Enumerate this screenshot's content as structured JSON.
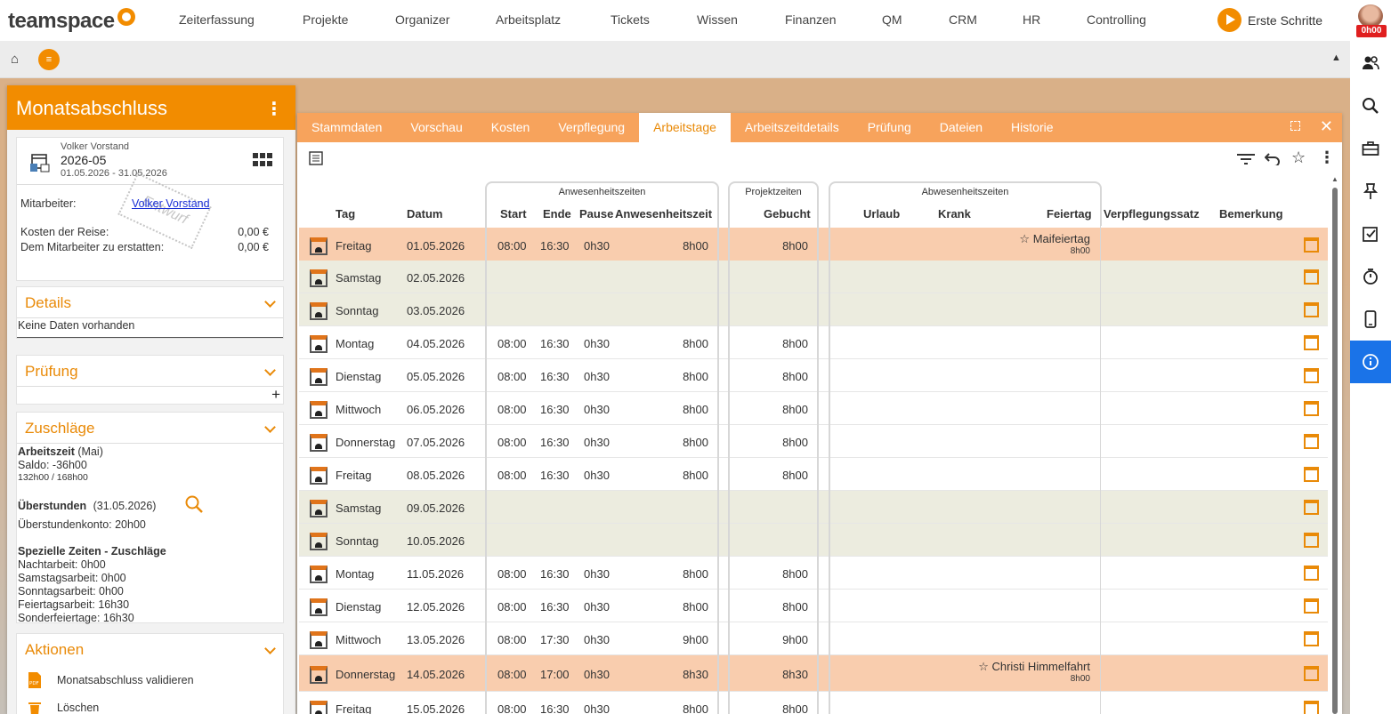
{
  "brand": {
    "logo_text": "teamspace"
  },
  "topnav": {
    "items": [
      "Zeiterfassung",
      "Projekte",
      "Organizer",
      "Arbeitsplatz",
      "Tickets",
      "Wissen",
      "Finanzen",
      "QM",
      "CRM",
      "HR",
      "Controlling"
    ],
    "erste_schritte": "Erste Schritte"
  },
  "user": {
    "time_badge": "0h00"
  },
  "left": {
    "title": "Monatsabschluss",
    "summary": {
      "employee_small": "Volker Vorstand",
      "period": "2026-05",
      "range": "01.05.2026 - 31.05.2026",
      "mitarbeiter_label": "Mitarbeiter:",
      "mitarbeiter_value": "Volker Vorstand",
      "kosten_label": "Kosten der Reise:",
      "kosten_value": "0,00 €",
      "erstatten_label": "Dem Mitarbeiter zu erstatten:",
      "erstatten_value": "0,00 €",
      "stamp": "Entwurf"
    },
    "details": {
      "title": "Details",
      "empty": "Keine Daten vorhanden"
    },
    "pruefung": {
      "title": "Prüfung"
    },
    "zuschlaege": {
      "title": "Zuschläge",
      "arbeitszeit_label": "Arbeitszeit",
      "arbeitszeit_month": "(Mai)",
      "saldo": "Saldo: -36h00",
      "ratio": "132h00 / 168h00",
      "ueberstunden_label": "Überstunden",
      "ueberstunden_date": "(31.05.2026)",
      "ueberstundenkonto": "Überstundenkonto: 20h00",
      "spezielle_title": "Spezielle Zeiten - Zuschläge",
      "nachtarbeit": "Nachtarbeit: 0h00",
      "samstagsarbeit": "Samstagsarbeit: 0h00",
      "sonntagsarbeit": "Sonntagsarbeit: 0h00",
      "feiertagsarbeit": "Feiertagsarbeit: 16h30",
      "sonderfeiertage": "Sonderfeiertage: 16h30"
    },
    "aktionen": {
      "title": "Aktionen",
      "validieren": "Monatsabschluss validieren",
      "loeschen": "Löschen"
    }
  },
  "main": {
    "tabs": [
      "Stammdaten",
      "Vorschau",
      "Kosten",
      "Verpflegung",
      "Arbeitstage",
      "Arbeitszeitdetails",
      "Prüfung",
      "Dateien",
      "Historie"
    ],
    "active_tab": "Arbeitstage",
    "groups": {
      "anwesenheit": "Anwesenheitszeiten",
      "projekt": "Projektzeiten",
      "abwesenheit": "Abwesenheitszeiten"
    },
    "columns": {
      "tag": "Tag",
      "datum": "Datum",
      "start": "Start",
      "ende": "Ende",
      "pause": "Pause",
      "anwesenheitszeit": "Anwesenheitszeit",
      "gebucht": "Gebucht",
      "urlaub": "Urlaub",
      "krank": "Krank",
      "feiertag": "Feiertag",
      "verpflegungssatz": "Verpflegungssatz",
      "bemerkung": "Bemerkung"
    },
    "rows": [
      {
        "type": "holiday",
        "tag": "Freitag",
        "datum": "01.05.2026",
        "start": "08:00",
        "ende": "16:30",
        "pause": "0h30",
        "anw": "8h00",
        "gebucht": "8h00",
        "feiertag": "Maifeiertag",
        "feiertag_h": "8h00"
      },
      {
        "type": "weekend",
        "tag": "Samstag",
        "datum": "02.05.2026",
        "start": "",
        "ende": "",
        "pause": "",
        "anw": "",
        "gebucht": "",
        "feiertag": "",
        "feiertag_h": ""
      },
      {
        "type": "weekend",
        "tag": "Sonntag",
        "datum": "03.05.2026",
        "start": "",
        "ende": "",
        "pause": "",
        "anw": "",
        "gebucht": "",
        "feiertag": "",
        "feiertag_h": ""
      },
      {
        "type": "normal",
        "tag": "Montag",
        "datum": "04.05.2026",
        "start": "08:00",
        "ende": "16:30",
        "pause": "0h30",
        "anw": "8h00",
        "gebucht": "8h00",
        "feiertag": "",
        "feiertag_h": ""
      },
      {
        "type": "normal",
        "tag": "Dienstag",
        "datum": "05.05.2026",
        "start": "08:00",
        "ende": "16:30",
        "pause": "0h30",
        "anw": "8h00",
        "gebucht": "8h00",
        "feiertag": "",
        "feiertag_h": ""
      },
      {
        "type": "normal",
        "tag": "Mittwoch",
        "datum": "06.05.2026",
        "start": "08:00",
        "ende": "16:30",
        "pause": "0h30",
        "anw": "8h00",
        "gebucht": "8h00",
        "feiertag": "",
        "feiertag_h": ""
      },
      {
        "type": "normal",
        "tag": "Donnerstag",
        "datum": "07.05.2026",
        "start": "08:00",
        "ende": "16:30",
        "pause": "0h30",
        "anw": "8h00",
        "gebucht": "8h00",
        "feiertag": "",
        "feiertag_h": ""
      },
      {
        "type": "normal",
        "tag": "Freitag",
        "datum": "08.05.2026",
        "start": "08:00",
        "ende": "16:30",
        "pause": "0h30",
        "anw": "8h00",
        "gebucht": "8h00",
        "feiertag": "",
        "feiertag_h": ""
      },
      {
        "type": "weekend",
        "tag": "Samstag",
        "datum": "09.05.2026",
        "start": "",
        "ende": "",
        "pause": "",
        "anw": "",
        "gebucht": "",
        "feiertag": "",
        "feiertag_h": ""
      },
      {
        "type": "weekend",
        "tag": "Sonntag",
        "datum": "10.05.2026",
        "start": "",
        "ende": "",
        "pause": "",
        "anw": "",
        "gebucht": "",
        "feiertag": "",
        "feiertag_h": ""
      },
      {
        "type": "normal",
        "tag": "Montag",
        "datum": "11.05.2026",
        "start": "08:00",
        "ende": "16:30",
        "pause": "0h30",
        "anw": "8h00",
        "gebucht": "8h00",
        "feiertag": "",
        "feiertag_h": ""
      },
      {
        "type": "normal",
        "tag": "Dienstag",
        "datum": "12.05.2026",
        "start": "08:00",
        "ende": "16:30",
        "pause": "0h30",
        "anw": "8h00",
        "gebucht": "8h00",
        "feiertag": "",
        "feiertag_h": ""
      },
      {
        "type": "normal",
        "tag": "Mittwoch",
        "datum": "13.05.2026",
        "start": "08:00",
        "ende": "17:30",
        "pause": "0h30",
        "anw": "9h00",
        "gebucht": "9h00",
        "feiertag": "",
        "feiertag_h": ""
      },
      {
        "type": "holiday",
        "tag": "Donnerstag",
        "datum": "14.05.2026",
        "start": "08:00",
        "ende": "17:00",
        "pause": "0h30",
        "anw": "8h30",
        "gebucht": "8h30",
        "feiertag": "Christi Himmelfahrt",
        "feiertag_h": "8h00"
      },
      {
        "type": "normal",
        "tag": "Freitag",
        "datum": "15.05.2026",
        "start": "08:00",
        "ende": "16:30",
        "pause": "0h30",
        "anw": "8h00",
        "gebucht": "8h00",
        "feiertag": "",
        "feiertag_h": ""
      }
    ]
  },
  "colors": {
    "accent": "#f28c00",
    "tab_bar": "#f7a35c",
    "holiday_row": "#f9cdae",
    "weekend_row": "#ececdf",
    "active_side": "#1a73e8"
  }
}
